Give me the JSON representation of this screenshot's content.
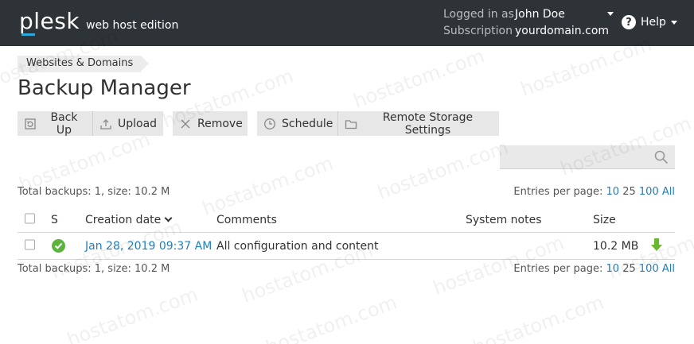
{
  "header": {
    "logo_text": "plesk",
    "edition": "web host edition",
    "logged_in_label": "Logged in as",
    "user_name": "John Doe",
    "subscription_label": "Subscription",
    "subscription_value": "yourdomain.com",
    "help_label": "Help"
  },
  "breadcrumb": {
    "item": "Websites & Domains"
  },
  "page_title": "Backup Manager",
  "toolbar": {
    "backup_label": "Back Up",
    "upload_label": "Upload",
    "remove_label": "Remove",
    "schedule_label": "Schedule",
    "remote_storage_label": "Remote Storage Settings"
  },
  "search": {
    "placeholder": ""
  },
  "summary": {
    "text": "Total backups: 1, size: 10.2 M",
    "entries_label": "Entries per page:",
    "options": [
      "10",
      "25",
      "100",
      "All"
    ]
  },
  "table": {
    "columns": {
      "s": "S",
      "creation_date": "Creation date",
      "comments": "Comments",
      "system_notes": "System notes",
      "size": "Size"
    },
    "rows": [
      {
        "status": "ok",
        "creation_date": "Jan 28, 2019 09:37 AM",
        "comments": "All configuration and content",
        "system_notes": "",
        "size": "10.2 MB"
      }
    ]
  },
  "watermark": "hostatom.com",
  "colors": {
    "topbar": "#2d3336",
    "link": "#1f7fc0",
    "accent": "#28aade",
    "status_ok": "#5cb53b",
    "download": "#6ab82e"
  }
}
